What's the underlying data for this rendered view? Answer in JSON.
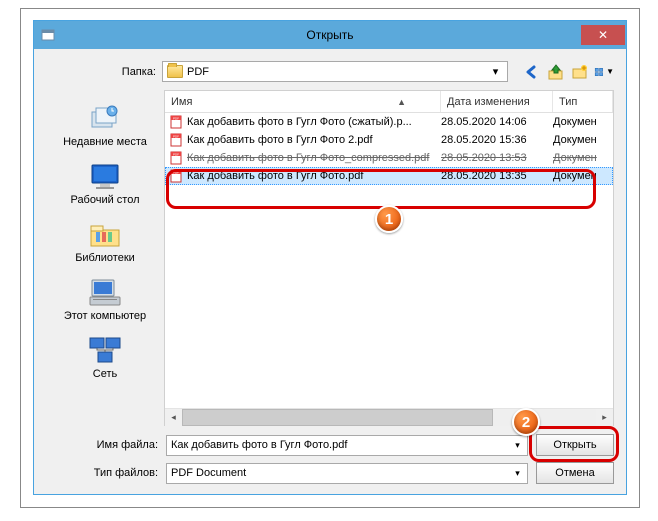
{
  "window": {
    "title": "Открыть",
    "close_glyph": "✕"
  },
  "folder_row": {
    "label": "Папка:",
    "current": "PDF"
  },
  "toolbar": {
    "back": "back-icon",
    "up": "up-icon",
    "newfolder": "new-folder-icon",
    "views": "views-icon"
  },
  "places": [
    {
      "id": "recent",
      "label": "Недавние места"
    },
    {
      "id": "desktop",
      "label": "Рабочий стол"
    },
    {
      "id": "libraries",
      "label": "Библиотеки"
    },
    {
      "id": "computer",
      "label": "Этот компьютер"
    },
    {
      "id": "network",
      "label": "Сеть"
    }
  ],
  "columns": {
    "name": "Имя",
    "date": "Дата изменения",
    "type": "Тип"
  },
  "files": [
    {
      "name": "Как добавить фото в Гугл Фото (сжатый).p...",
      "date": "28.05.2020 14:06",
      "type": "Докумен",
      "struck": false,
      "selected": false
    },
    {
      "name": "Как добавить фото в Гугл Фото 2.pdf",
      "date": "28.05.2020 15:36",
      "type": "Докумен",
      "struck": false,
      "selected": false
    },
    {
      "name": "Как добавить фото в Гугл Фото_compressed.pdf",
      "date": "28.05.2020 13:53",
      "type": "Докумен",
      "struck": true,
      "selected": false
    },
    {
      "name": "Как добавить фото в Гугл Фото.pdf",
      "date": "28.05.2020 13:35",
      "type": "Докумен",
      "struck": false,
      "selected": true
    }
  ],
  "bottom": {
    "filename_label": "Имя файла:",
    "filename_value": "Как добавить фото в Гугл Фото.pdf",
    "filter_label": "Тип файлов:",
    "filter_value": "PDF Document",
    "open": "Открыть",
    "cancel": "Отмена"
  },
  "callouts": {
    "one": "1",
    "two": "2"
  }
}
